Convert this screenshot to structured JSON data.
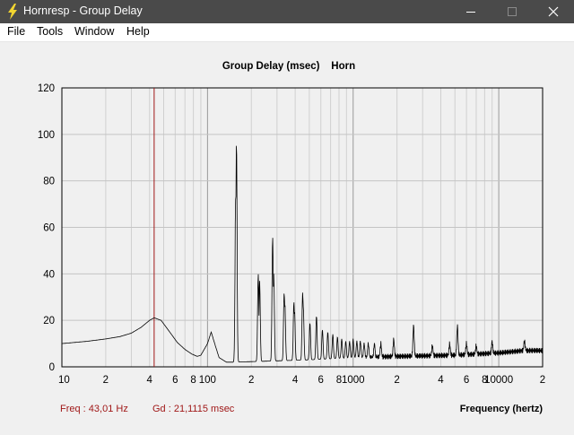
{
  "window": {
    "title": "Hornresp - Group Delay",
    "app_icon": "lightning-bolt-icon",
    "controls": [
      "minimize-icon",
      "maximize-icon",
      "close-icon"
    ]
  },
  "menu": {
    "items": [
      {
        "label": "File"
      },
      {
        "label": "Tools"
      },
      {
        "label": "Window"
      },
      {
        "label": "Help"
      }
    ]
  },
  "status": {
    "freq": "Freq : 43,01 Hz",
    "gd": "Gd : 21,1115 msec"
  },
  "chart_data": {
    "type": "line",
    "title": "Group Delay (msec)    Horn",
    "xlabel": "Frequency (hertz)",
    "ylabel": "",
    "x_scale": "log",
    "xlim": [
      10,
      20000
    ],
    "ylim": [
      0,
      120
    ],
    "grid": true,
    "x_tick_labels": [
      {
        "value": 10,
        "label": "10"
      },
      {
        "value": 20,
        "label": "2"
      },
      {
        "value": 40,
        "label": "4"
      },
      {
        "value": 60,
        "label": "6"
      },
      {
        "value": 80,
        "label": "8"
      },
      {
        "value": 100,
        "label": "100"
      },
      {
        "value": 200,
        "label": "2"
      },
      {
        "value": 400,
        "label": "4"
      },
      {
        "value": 600,
        "label": "6"
      },
      {
        "value": 800,
        "label": "8"
      },
      {
        "value": 1000,
        "label": "1000"
      },
      {
        "value": 2000,
        "label": "2"
      },
      {
        "value": 4000,
        "label": "4"
      },
      {
        "value": 6000,
        "label": "6"
      },
      {
        "value": 8000,
        "label": "8"
      },
      {
        "value": 10000,
        "label": "10000"
      },
      {
        "value": 20000,
        "label": "2"
      }
    ],
    "y_tick_labels": [
      {
        "value": 0,
        "label": "0"
      },
      {
        "value": 20,
        "label": "20"
      },
      {
        "value": 40,
        "label": "40"
      },
      {
        "value": 60,
        "label": "60"
      },
      {
        "value": 80,
        "label": "80"
      },
      {
        "value": 100,
        "label": "100"
      },
      {
        "value": 120,
        "label": "120"
      }
    ],
    "cursor": {
      "x": 43.01,
      "color": "#a01818"
    },
    "series": [
      {
        "color": "#000000",
        "baseline": [
          [
            10,
            10.0
          ],
          [
            15,
            11.0
          ],
          [
            20,
            12.0
          ],
          [
            25,
            13.0
          ],
          [
            30,
            14.5
          ],
          [
            35,
            17.0
          ],
          [
            40,
            20.0
          ],
          [
            43,
            21.1
          ],
          [
            48,
            20.0
          ],
          [
            55,
            15.0
          ],
          [
            62,
            10.5
          ],
          [
            70,
            7.5
          ],
          [
            78,
            5.5
          ],
          [
            85,
            4.5
          ],
          [
            90,
            5.0
          ],
          [
            100,
            10.0
          ],
          [
            106,
            15.0
          ],
          [
            112,
            10.0
          ],
          [
            120,
            4.0
          ],
          [
            135,
            2.0
          ],
          [
            150,
            2.0
          ],
          [
            500,
            3.0
          ],
          [
            1000,
            4.0
          ],
          [
            2000,
            4.5
          ],
          [
            5000,
            5.0
          ],
          [
            10000,
            6.0
          ],
          [
            15000,
            7.0
          ],
          [
            20000,
            7.0
          ]
        ],
        "peaks": [
          {
            "f": 158,
            "y": 97
          },
          {
            "f": 156,
            "y": 72
          },
          {
            "f": 223,
            "y": 40
          },
          {
            "f": 228,
            "y": 37
          },
          {
            "f": 280,
            "y": 56
          },
          {
            "f": 285,
            "y": 40
          },
          {
            "f": 336,
            "y": 32
          },
          {
            "f": 340,
            "y": 27
          },
          {
            "f": 392,
            "y": 28
          },
          {
            "f": 396,
            "y": 24
          },
          {
            "f": 450,
            "y": 32
          },
          {
            "f": 455,
            "y": 26
          },
          {
            "f": 505,
            "y": 19
          },
          {
            "f": 560,
            "y": 22
          },
          {
            "f": 615,
            "y": 16
          },
          {
            "f": 670,
            "y": 15
          },
          {
            "f": 725,
            "y": 14
          },
          {
            "f": 780,
            "y": 13
          },
          {
            "f": 835,
            "y": 12
          },
          {
            "f": 890,
            "y": 11
          },
          {
            "f": 945,
            "y": 11
          },
          {
            "f": 1000,
            "y": 12
          },
          {
            "f": 1060,
            "y": 11
          },
          {
            "f": 1120,
            "y": 11
          },
          {
            "f": 1190,
            "y": 10
          },
          {
            "f": 1270,
            "y": 10
          },
          {
            "f": 1400,
            "y": 10
          },
          {
            "f": 1550,
            "y": 10
          },
          {
            "f": 1900,
            "y": 12
          },
          {
            "f": 2600,
            "y": 18
          },
          {
            "f": 3500,
            "y": 9
          },
          {
            "f": 4600,
            "y": 10
          },
          {
            "f": 5200,
            "y": 18
          },
          {
            "f": 6000,
            "y": 10
          },
          {
            "f": 7000,
            "y": 9
          },
          {
            "f": 9000,
            "y": 11
          },
          {
            "f": 15000,
            "y": 11
          }
        ]
      }
    ]
  }
}
